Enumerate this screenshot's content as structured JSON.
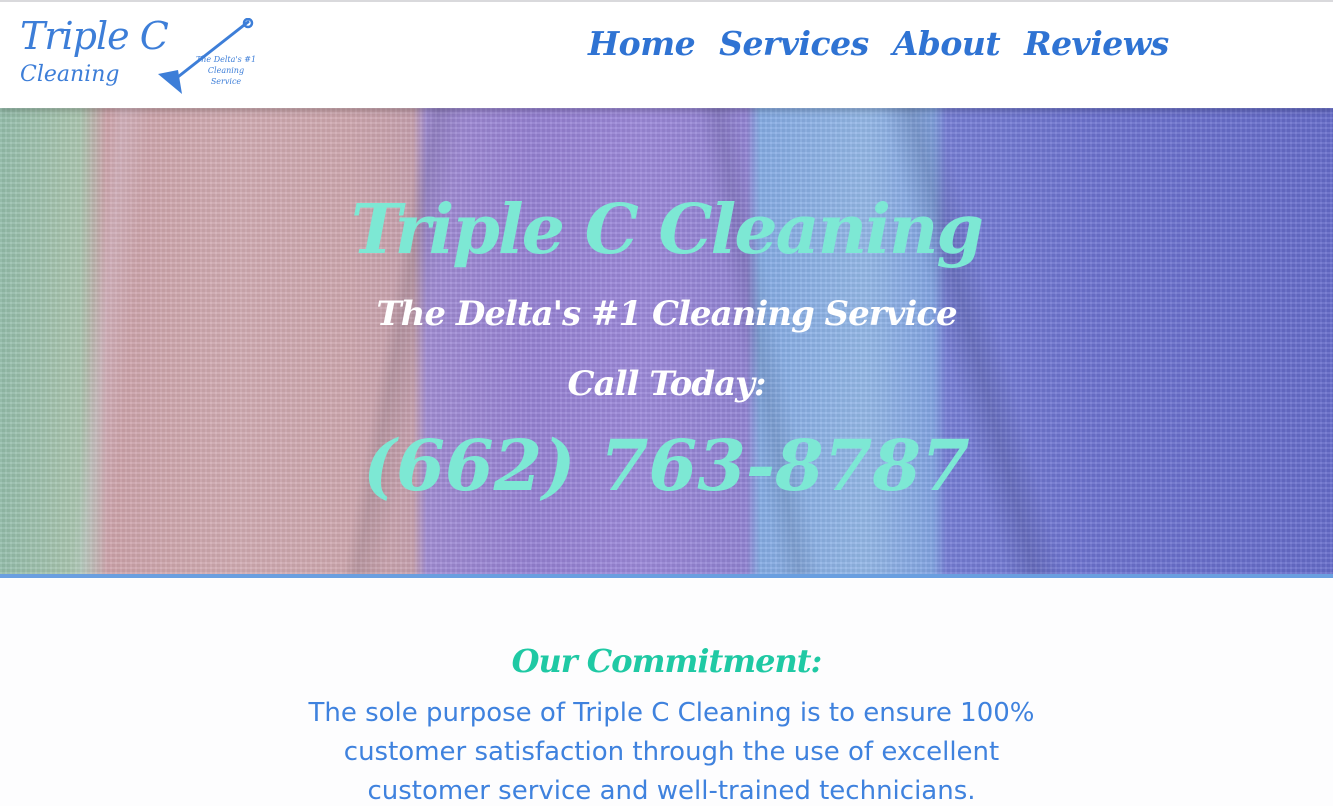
{
  "header": {
    "logo": {
      "line1": "Triple C",
      "line2": "Cleaning",
      "tagline": "The Delta's #1 Cleaning Service",
      "icon": "mop-icon"
    },
    "nav": [
      {
        "label": "Home"
      },
      {
        "label": "Services"
      },
      {
        "label": "About"
      },
      {
        "label": "Reviews"
      }
    ]
  },
  "hero": {
    "title": "Triple C Cleaning",
    "subtitle": "The Delta's #1 Cleaning Service",
    "call_label": "Call Today:",
    "phone": "(662) 763-8787"
  },
  "commitment": {
    "title": "Our Commitment:",
    "body": "The sole purpose of Triple C Cleaning is to ensure 100% customer satisfaction through the use of excellent customer service and well-trained technicians."
  },
  "colors": {
    "brand_blue": "#3d7ed8",
    "nav_blue": "#2f73d3",
    "mint": "#7de8d4",
    "teal": "#1fc9a4",
    "hero_border": "#6a9fe0"
  }
}
